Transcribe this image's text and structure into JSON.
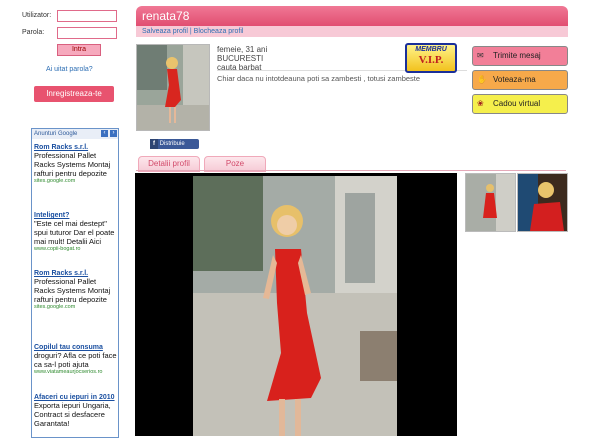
{
  "login": {
    "user_label": "Utilizator:",
    "pass_label": "Parola:",
    "submit": "Intra",
    "forgot": "Ai uitat parola?",
    "register": "Inregistreaza-te"
  },
  "ads": {
    "header": "Anunturi Google",
    "items": [
      {
        "title": "Rom Racks s.r.l.",
        "body": "Professional Pallet Racks Systems Montaj rafturi pentru depozite",
        "url": "sites.google.com"
      },
      {
        "title": "Inteligent?",
        "body": "\"Este cel mai destept\" spui tuturor Dar el poate mai mult! Detalii Aici",
        "url": "www.copii-bogat.ro"
      },
      {
        "title": "Rom Racks s.r.l.",
        "body": "Professional Pallet Racks Systems Montaj rafturi pentru depozite",
        "url": "sites.google.com"
      },
      {
        "title": "Copilul tau consuma",
        "body": "droguri? Afla ce poti face ca sa-l poti ajuta",
        "url": "www.viatameaurjocserios.ro"
      },
      {
        "title": "Afaceri cu iepuri in 2010",
        "body": "Exporta iepuri Ungaria, Contract si desfacere Garantata!",
        "url": ""
      }
    ]
  },
  "profile": {
    "username": "renata78",
    "save": "Salveaza profil",
    "sep": "|",
    "block": "Blocheaza profil",
    "info_line1": "femeie, 31 ani",
    "city": "BUCURESTI",
    "seeking": "cauta barbat",
    "quote": "Chiar daca nu intotdeauna poti sa zambesti , totusi zambeste",
    "vip_top": "MEMBRU",
    "vip_main": "V.I.P.",
    "share": "Distribuie"
  },
  "actions": [
    {
      "label": "Trimite mesaj",
      "bg": "#f27f98"
    },
    {
      "label": "Voteaza-ma",
      "bg": "#f7a94a"
    },
    {
      "label": "Cadou virtual",
      "bg": "#f5ef4c"
    }
  ],
  "tabs": [
    "Detalii profil",
    "Poze"
  ]
}
